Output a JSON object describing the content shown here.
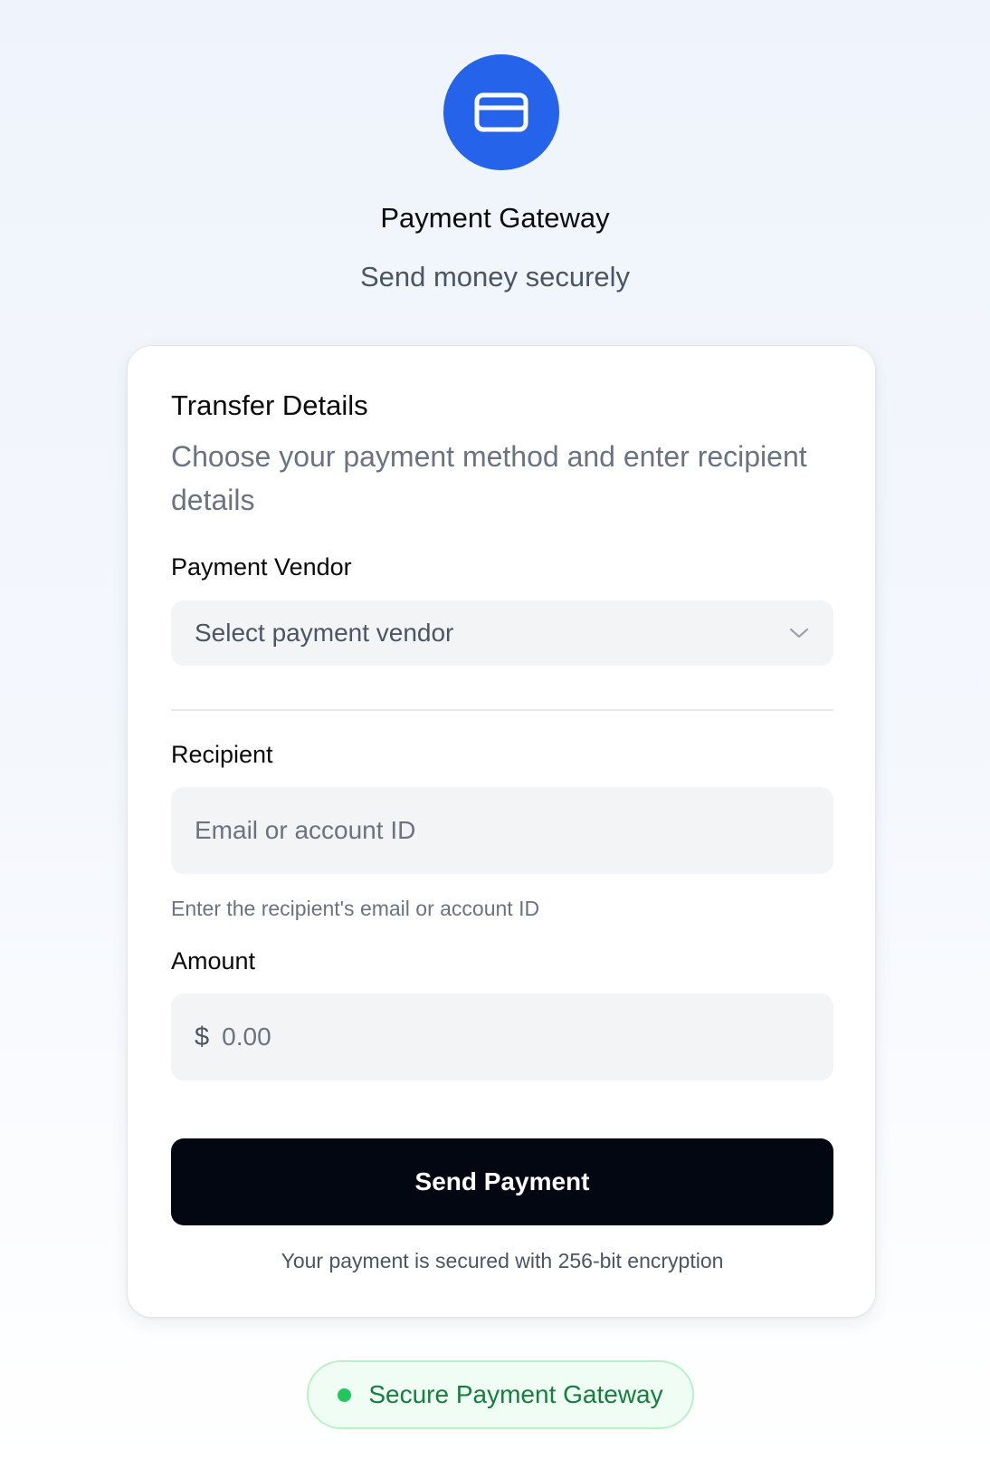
{
  "header": {
    "logo_icon": "credit-card-icon",
    "title": "Payment Gateway",
    "subtitle": "Send money securely"
  },
  "card": {
    "title": "Transfer Details",
    "description": "Choose your payment method and enter recipient details"
  },
  "vendor": {
    "label": "Payment Vendor",
    "placeholder": "Select payment vendor",
    "icon": "chevron-down-icon"
  },
  "recipient": {
    "label": "Recipient",
    "placeholder": "Email or account ID",
    "value": "",
    "helper": "Enter the recipient's email or account ID"
  },
  "amount": {
    "label": "Amount",
    "currency_symbol": "$",
    "placeholder": "0.00",
    "value": ""
  },
  "actions": {
    "send_label": "Send Payment"
  },
  "security_note": "Your payment is secured with 256-bit encryption",
  "badge": {
    "label": "Secure Payment Gateway",
    "status_color": "#22c55e"
  },
  "colors": {
    "accent": "#2563eb",
    "button_bg": "#030712",
    "badge_text": "#15803d"
  }
}
